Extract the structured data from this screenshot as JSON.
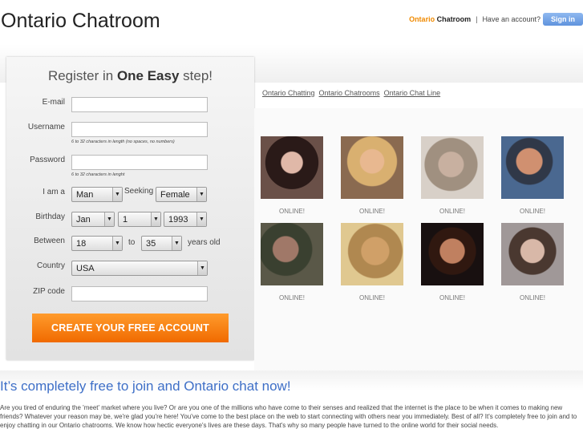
{
  "header": {
    "site_title": "Ontario Chatroom",
    "brand_orange": "Ontario",
    "brand_dark": "Chatroom",
    "separator": "|",
    "have_account": "Have an account?",
    "signin": "Sign in"
  },
  "register": {
    "heading_pre": "Register in ",
    "heading_bold": "One Easy",
    "heading_post": " step!",
    "email_label": "E-mail",
    "username_label": "Username",
    "username_hint": "6 to 32 characters in length (no spaces, no numbers)",
    "password_label": "Password",
    "password_hint": "6 to 32 characters in lenght",
    "iam_label": "I am a",
    "iam_value": "Man",
    "seeking_label": "Seeking",
    "seeking_value": "Female",
    "birthday_label": "Birthday",
    "birth_month": "Jan",
    "birth_day": "1",
    "birth_year": "1993",
    "between_label": "Between",
    "age_min": "18",
    "to_label": "to",
    "age_max": "35",
    "years_old": "years old",
    "country_label": "Country",
    "country_value": "USA",
    "zip_label": "ZIP code",
    "create_button": "CREATE YOUR FREE ACCOUNT"
  },
  "links": [
    "Ontario Chatting",
    "Ontario Chatrooms",
    "Ontario Chat Line"
  ],
  "profiles": [
    {
      "status": "ONLINE!"
    },
    {
      "status": "ONLINE!"
    },
    {
      "status": "ONLINE!"
    },
    {
      "status": "ONLINE!"
    },
    {
      "status": "ONLINE!"
    },
    {
      "status": "ONLINE!"
    },
    {
      "status": "ONLINE!"
    },
    {
      "status": "ONLINE!"
    }
  ],
  "tagline": "It’s completely free to join and Ontario chat now!",
  "paragraph": "Are you tired of enduring the 'meet' market where you live? Or are you one of the millions who have come to their senses and realized that the internet is the place to be when it comes to making new friends? Whatever your reason may be, we're glad you're here! You've come to the best place on the web to start connecting with others near you immediately. Best of all? It's completely free to join and to enjoy chatting in our Ontario chatrooms. We know how hectic everyone's lives are these days. That's why so many people have turned to the online world for their social needs.",
  "colors": {
    "accent_orange": "#f08a00",
    "signin_blue": "#5f93dd",
    "tagline_blue": "#3e6fc7"
  }
}
